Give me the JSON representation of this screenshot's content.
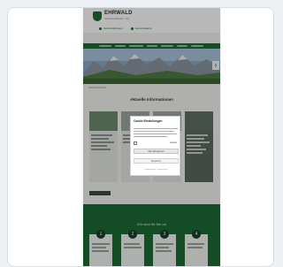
{
  "site": {
    "name": "EHRWALD",
    "subtitle": "Gemeinde Ehrwald · Tirol",
    "quick_links": [
      "Veranstaltungen",
      "Gemeindeamt"
    ]
  },
  "hero": {
    "next_icon": "chevron-right-icon"
  },
  "section": {
    "title": "Aktuelle Informationen"
  },
  "footer": {
    "title": "Wir sind für Sie da",
    "steps": [
      "1",
      "2",
      "3",
      "4"
    ]
  },
  "modal": {
    "title": "Cookie Einstellungen",
    "details_link": "Details",
    "accept_label": "Alle akzeptieren",
    "save_label": "Speichern",
    "footer_text": "Datenschutz · Impressum"
  },
  "colors": {
    "brand_green": "#1f6b3a",
    "footer_green": "#1c6b34"
  }
}
